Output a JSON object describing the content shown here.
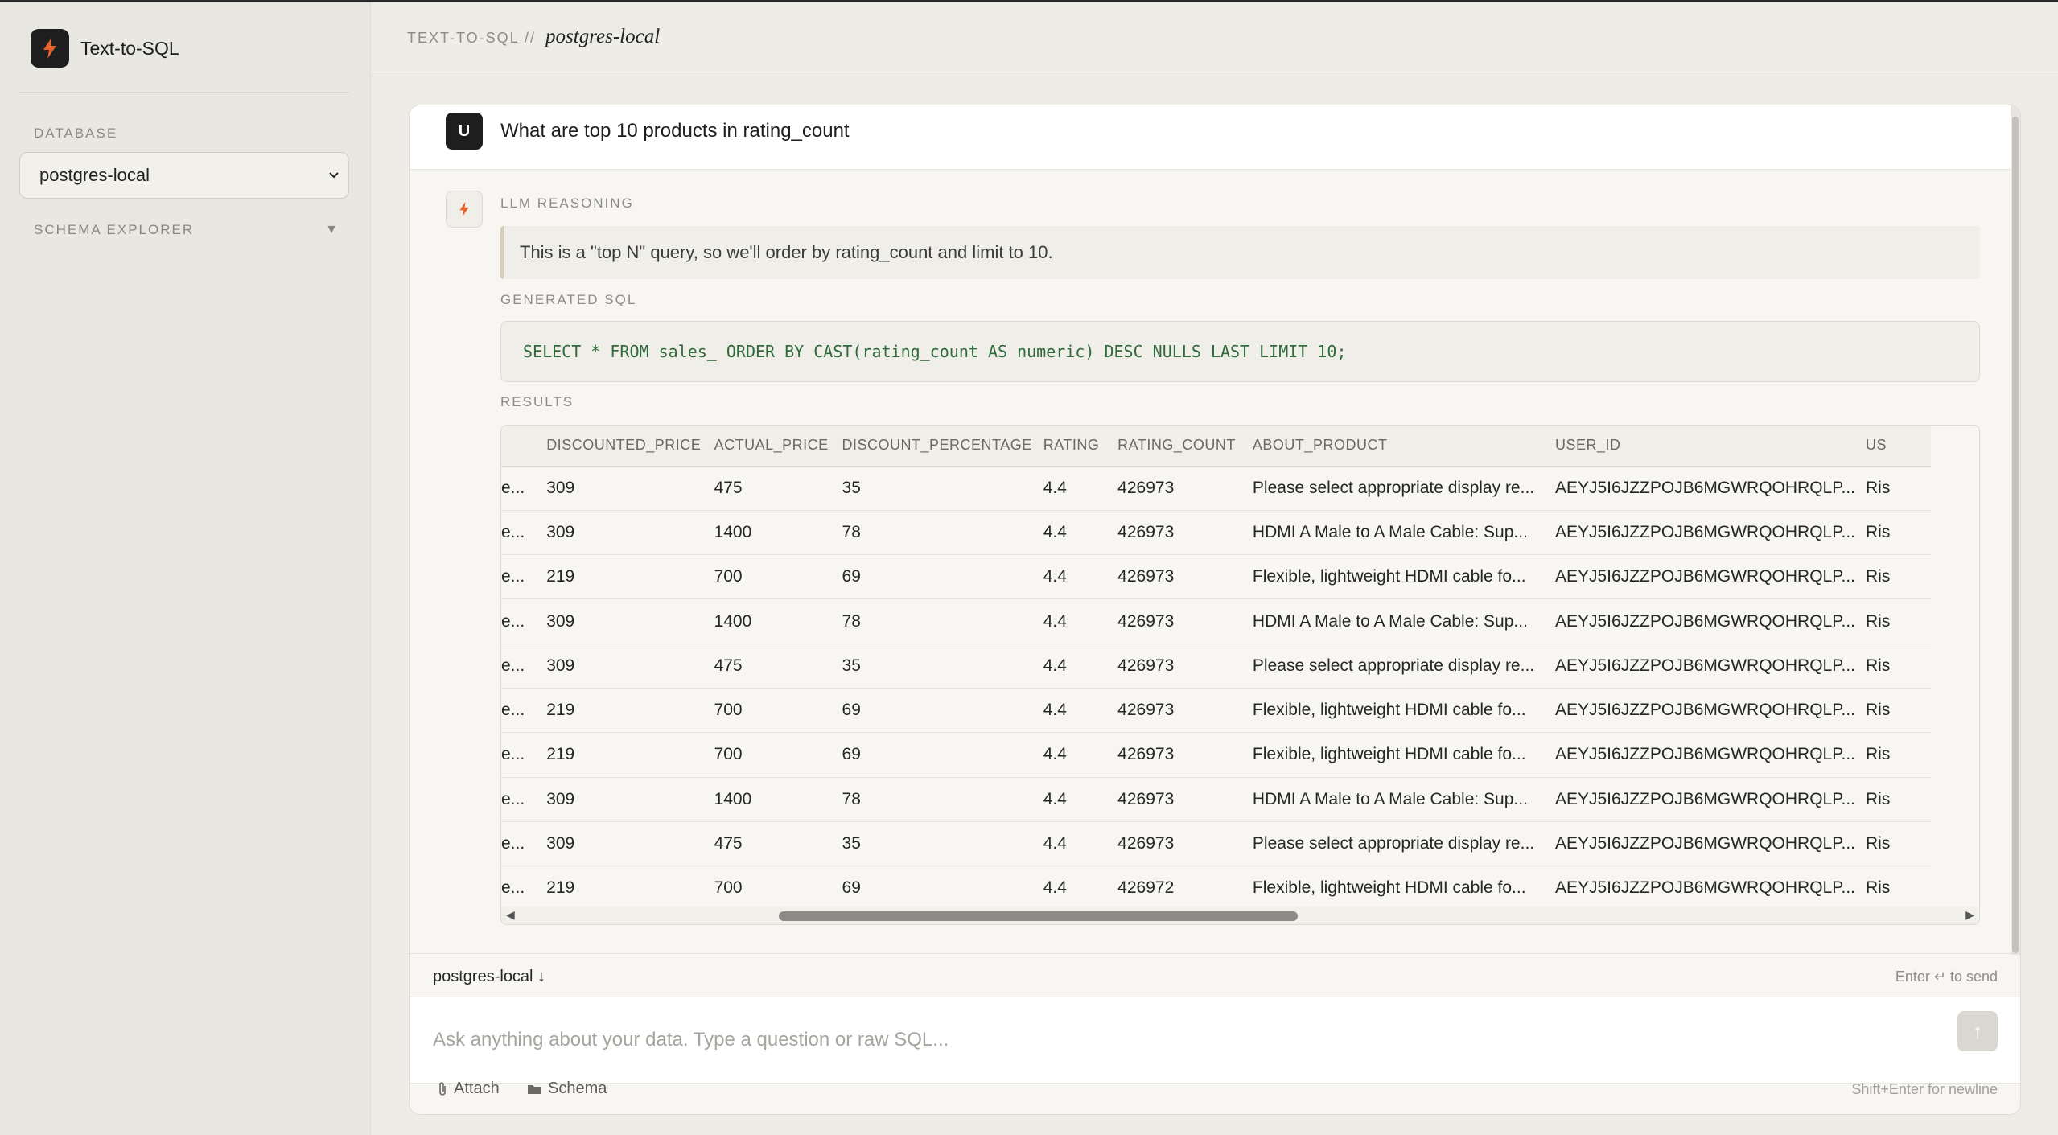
{
  "app": {
    "title": "Text-to-SQL"
  },
  "sidebar": {
    "database_label": "DATABASE",
    "database_selected": "postgres-local",
    "schema_label": "SCHEMA EXPLORER"
  },
  "breadcrumb": {
    "root": "TEXT-TO-SQL //",
    "current": "postgres-local"
  },
  "conversation": {
    "user_initial": "U",
    "question": "What are top 10 products in rating_count",
    "reasoning_label": "LLM REASONING",
    "reasoning": "This is a \"top N\" query, so we'll order by rating_count and limit to 10.",
    "sql_label": "GENERATED SQL",
    "sql": "SELECT * FROM sales_ ORDER BY CAST(rating_count AS numeric) DESC NULLS LAST LIMIT 10;",
    "results_label": "RESULTS"
  },
  "results": {
    "columns": [
      "",
      "DISCOUNTED_PRICE",
      "ACTUAL_PRICE",
      "DISCOUNT_PERCENTAGE",
      "RATING",
      "RATING_COUNT",
      "ABOUT_PRODUCT",
      "USER_ID",
      "US"
    ],
    "rows": [
      [
        "e...",
        "309",
        "475",
        "35",
        "4.4",
        "426973",
        "Please select appropriate display re...",
        "AEYJ5I6JZZPOJB6MGWRQOHRQLP...",
        "Ris"
      ],
      [
        "e...",
        "309",
        "1400",
        "78",
        "4.4",
        "426973",
        "HDMI A Male to A Male Cable: Sup...",
        "AEYJ5I6JZZPOJB6MGWRQOHRQLP...",
        "Ris"
      ],
      [
        "e...",
        "219",
        "700",
        "69",
        "4.4",
        "426973",
        "Flexible, lightweight HDMI cable fo...",
        "AEYJ5I6JZZPOJB6MGWRQOHRQLP...",
        "Ris"
      ],
      [
        "e...",
        "309",
        "1400",
        "78",
        "4.4",
        "426973",
        "HDMI A Male to A Male Cable: Sup...",
        "AEYJ5I6JZZPOJB6MGWRQOHRQLP...",
        "Ris"
      ],
      [
        "e...",
        "309",
        "475",
        "35",
        "4.4",
        "426973",
        "Please select appropriate display re...",
        "AEYJ5I6JZZPOJB6MGWRQOHRQLP...",
        "Ris"
      ],
      [
        "e...",
        "219",
        "700",
        "69",
        "4.4",
        "426973",
        "Flexible, lightweight HDMI cable fo...",
        "AEYJ5I6JZZPOJB6MGWRQOHRQLP...",
        "Ris"
      ],
      [
        "e...",
        "219",
        "700",
        "69",
        "4.4",
        "426973",
        "Flexible, lightweight HDMI cable fo...",
        "AEYJ5I6JZZPOJB6MGWRQOHRQLP...",
        "Ris"
      ],
      [
        "e...",
        "309",
        "1400",
        "78",
        "4.4",
        "426973",
        "HDMI A Male to A Male Cable: Sup...",
        "AEYJ5I6JZZPOJB6MGWRQOHRQLP...",
        "Ris"
      ],
      [
        "e...",
        "309",
        "475",
        "35",
        "4.4",
        "426973",
        "Please select appropriate display re...",
        "AEYJ5I6JZZPOJB6MGWRQOHRQLP...",
        "Ris"
      ],
      [
        "e...",
        "219",
        "700",
        "69",
        "4.4",
        "426972",
        "Flexible, lightweight HDMI cable fo...",
        "AEYJ5I6JZZPOJB6MGWRQOHRQLP...",
        "Ris"
      ]
    ]
  },
  "composer": {
    "database": "postgres-local ↓",
    "send_hint": "Enter ↵ to send",
    "placeholder": "Ask anything about your data. Type a question or raw SQL...",
    "send_icon": "↑",
    "attach_label": "Attach",
    "schema_label": "Schema",
    "newline_hint": "Shift+Enter for newline"
  },
  "colors": {
    "accent": "#e8622a",
    "dark": "#1e1e1e",
    "sql_text": "#2f6b3a"
  }
}
